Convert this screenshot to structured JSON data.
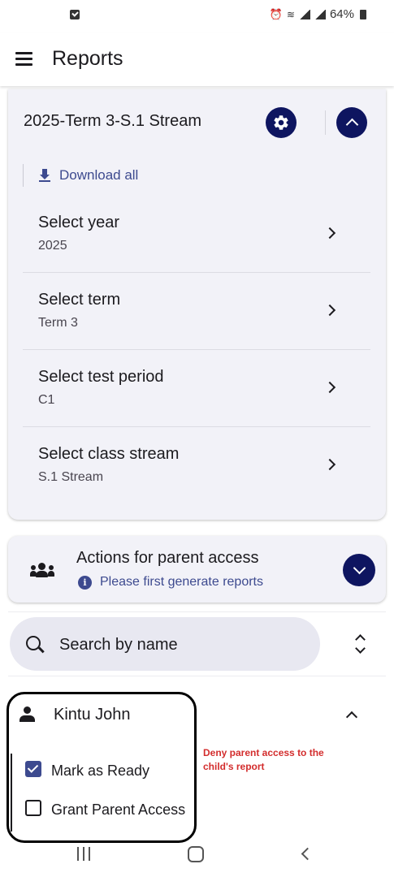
{
  "status_bar": {
    "battery": "64%"
  },
  "app_bar": {
    "title": "Reports",
    "menu_icon": "hamburger-menu-icon"
  },
  "report_card": {
    "title": "2025-Term 3-S.1 Stream",
    "download_label": "Download all",
    "selectors": [
      {
        "label": "Select year",
        "value": "2025"
      },
      {
        "label": "Select term",
        "value": "Term 3"
      },
      {
        "label": "Select test period",
        "value": "C1"
      },
      {
        "label": "Select class stream",
        "value": "S.1 Stream"
      }
    ]
  },
  "parent_access_card": {
    "title": "Actions for parent access",
    "info": "Please first generate reports"
  },
  "search": {
    "placeholder": "Search by name"
  },
  "student": {
    "name": "Kintu John",
    "options": [
      {
        "label": "Mark as Ready",
        "checked": true
      },
      {
        "label": "Grant Parent Access",
        "checked": false
      }
    ]
  },
  "annotation": {
    "text": "Deny parent access to the child's report"
  },
  "colors": {
    "accent": "#0e1560",
    "link": "#3d4a8f",
    "card_bg": "#f2f2f8",
    "annotation": "#d32d2d"
  }
}
